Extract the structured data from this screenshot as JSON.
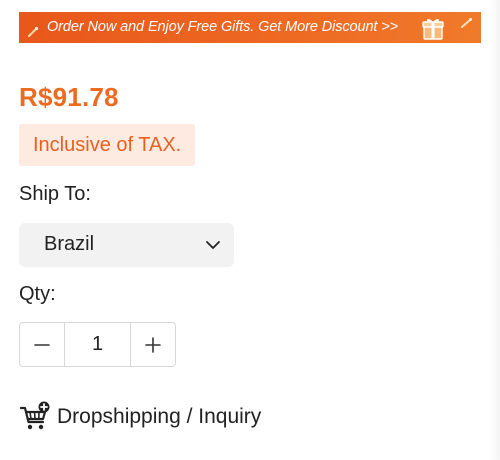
{
  "promo": {
    "text": "Order Now and Enjoy Free Gifts. Get More Discount >>",
    "icon": "gift-icon"
  },
  "price": "R$91.78",
  "tax_badge": "Inclusive of TAX.",
  "shipping": {
    "label": "Ship To:",
    "selected_country": "Brazil",
    "icon": "chevron-down-icon"
  },
  "quantity": {
    "label": "Qty:",
    "value": "1",
    "decrement_icon": "minus-icon",
    "increment_icon": "plus-icon"
  },
  "dropshipping": {
    "label": "Dropshipping / Inquiry",
    "icon": "cart-plus-icon"
  },
  "colors": {
    "accent": "#ee6a1f",
    "tax_badge_bg": "#fdebe1",
    "select_bg": "#f2f2f2"
  }
}
